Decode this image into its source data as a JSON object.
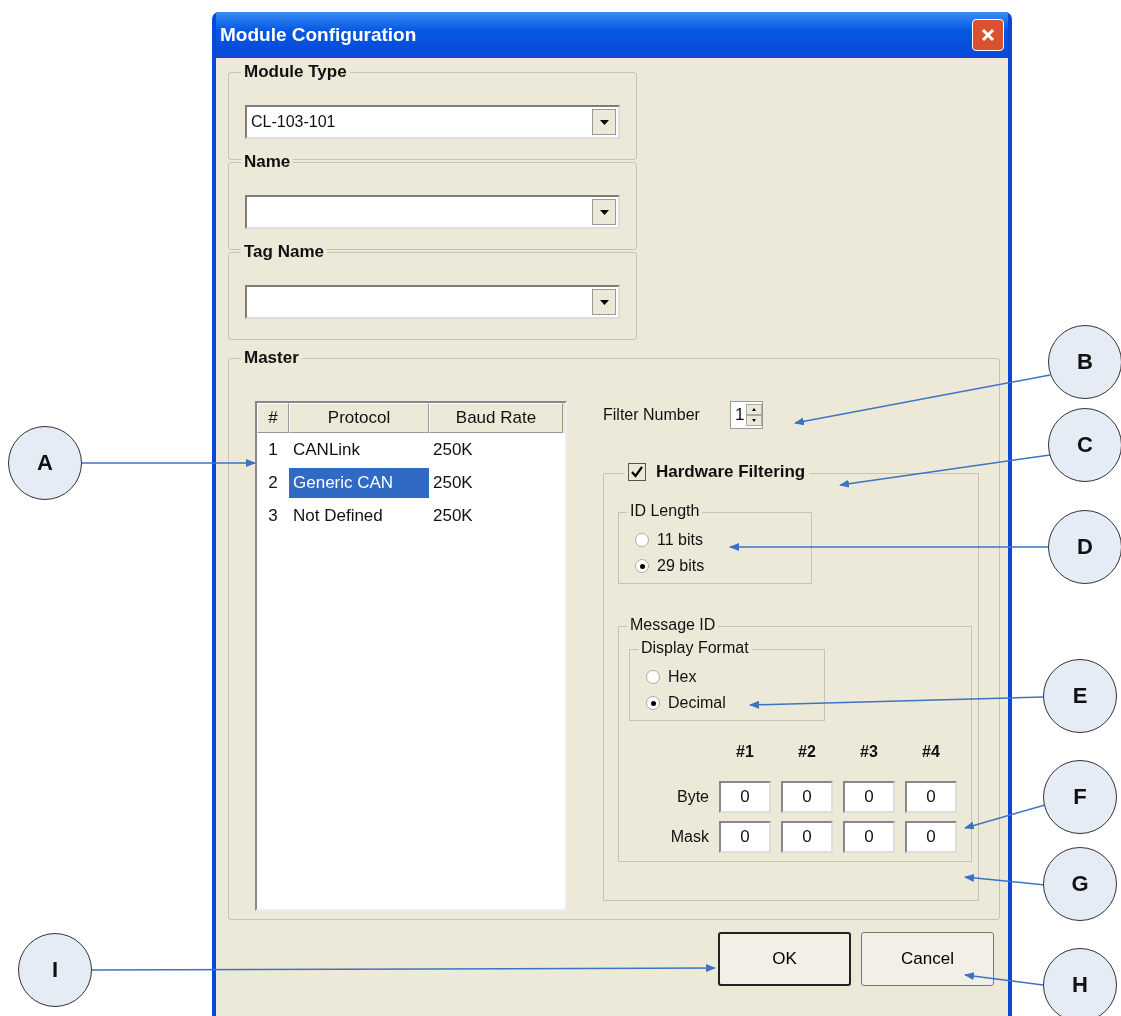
{
  "window": {
    "title": "Module Configuration"
  },
  "module_type": {
    "label": "Module Type",
    "value": "CL-103-101"
  },
  "name": {
    "label": "Name"
  },
  "tag_name": {
    "label": "Tag Name"
  },
  "master": {
    "label": "Master",
    "table": {
      "columns": [
        "#",
        "Protocol",
        "Baud Rate"
      ],
      "rows": [
        {
          "cells": [
            "1",
            "CANLink",
            "250K"
          ],
          "selected": false
        },
        {
          "cells": [
            "2",
            "Generic CAN",
            "250K"
          ],
          "selected": true
        },
        {
          "cells": [
            "3",
            "Not Defined",
            "250K"
          ],
          "selected": false
        }
      ]
    },
    "filter_number": {
      "label": "Filter Number",
      "value": "1"
    },
    "hardware_filtering": {
      "label": "Hardware Filtering",
      "checked": true
    },
    "id_length": {
      "label": "ID Length",
      "options": [
        {
          "label": "11 bits",
          "selected": false
        },
        {
          "label": "29 bits",
          "selected": true
        }
      ]
    },
    "message_id": {
      "label": "Message ID",
      "display_format": {
        "label": "Display Format",
        "options": [
          {
            "label": "Hex",
            "selected": false
          },
          {
            "label": "Decimal",
            "selected": true
          }
        ]
      },
      "columns": [
        "#1",
        "#2",
        "#3",
        "#4"
      ],
      "rows": [
        {
          "label": "Byte",
          "values": [
            "0",
            "0",
            "0",
            "0"
          ]
        },
        {
          "label": "Mask",
          "values": [
            "0",
            "0",
            "0",
            "0"
          ]
        }
      ]
    }
  },
  "buttons": [
    {
      "label": "OK",
      "default": true
    },
    {
      "label": "Cancel",
      "default": false
    }
  ],
  "callouts": [
    {
      "letter": "A"
    },
    {
      "letter": "B"
    },
    {
      "letter": "C"
    },
    {
      "letter": "D"
    },
    {
      "letter": "E"
    },
    {
      "letter": "F"
    },
    {
      "letter": "G"
    },
    {
      "letter": "I"
    },
    {
      "letter": "H"
    }
  ]
}
